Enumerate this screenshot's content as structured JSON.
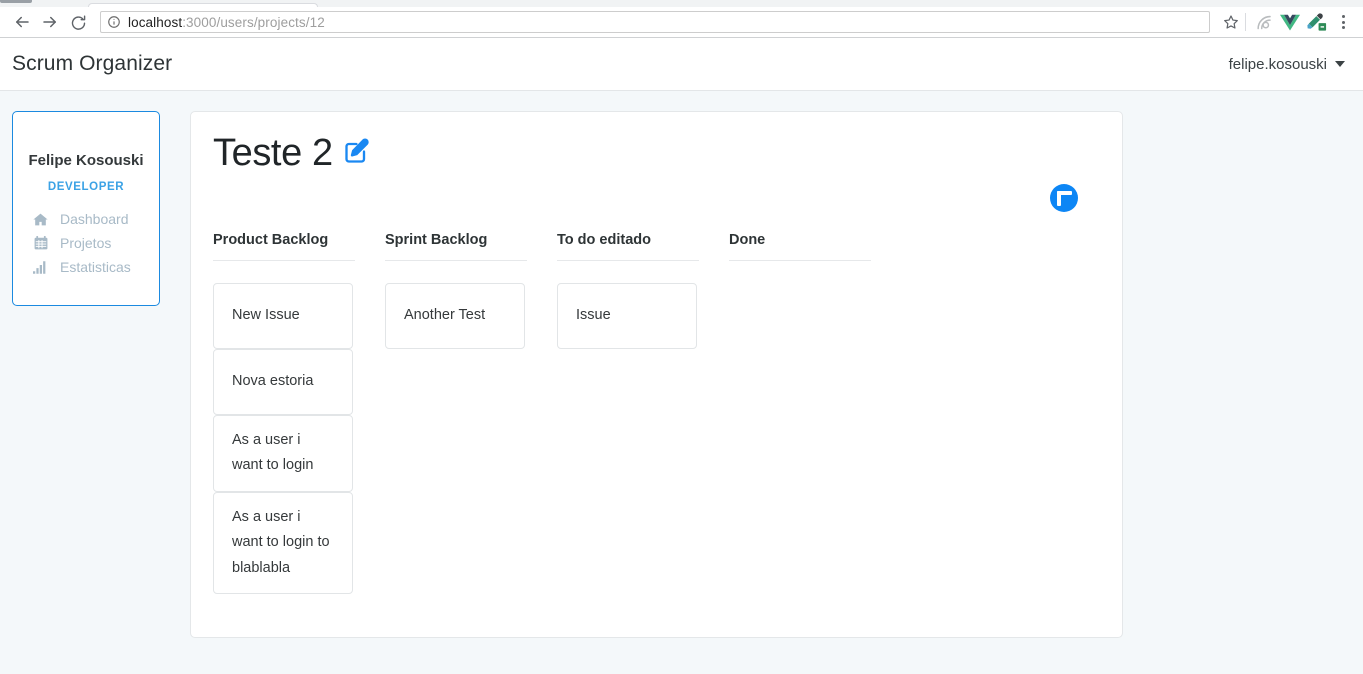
{
  "browser": {
    "back_icon": "arrow-left-icon",
    "forward_icon": "arrow-right-icon",
    "reload_icon": "reload-icon",
    "info_icon": "info-circle-icon",
    "url_host": "localhost",
    "url_path": ":3000/users/projects/12",
    "star_icon": "bookmark-star-icon",
    "extensions": [
      {
        "name": "reader-extension-icon"
      },
      {
        "name": "vue-devtools-icon"
      },
      {
        "name": "eyedropper-extension-icon"
      }
    ],
    "menu_icon": "three-dot-menu-icon"
  },
  "navbar": {
    "brand": "Scrum Organizer",
    "user": "felipe.kosouski",
    "caret_icon": "caret-down-icon"
  },
  "sidebar": {
    "name": "Felipe Kosouski",
    "role": "DEVELOPER",
    "items": [
      {
        "label": "Dashboard",
        "icon": "home-icon"
      },
      {
        "label": "Projetos",
        "icon": "calendar-icon"
      },
      {
        "label": "Estatisticas",
        "icon": "bar-chart-icon"
      }
    ]
  },
  "board": {
    "title": "Teste 2",
    "edit_icon": "edit-pencil-square-icon",
    "add_icon": "plus-circle-icon",
    "columns": [
      {
        "title": "Product Backlog",
        "cards": [
          {
            "text": "New Issue"
          },
          {
            "text": "Nova estoria"
          },
          {
            "text": "As a user i want to login"
          },
          {
            "text": "As a user i want to login to blablabla"
          }
        ]
      },
      {
        "title": "Sprint Backlog",
        "cards": [
          {
            "text": "Another Test"
          }
        ]
      },
      {
        "title": "To do editado",
        "cards": [
          {
            "text": "Issue"
          }
        ]
      },
      {
        "title": "Done",
        "cards": []
      }
    ]
  },
  "colors": {
    "accent_blue": "#0d86f5",
    "role_blue": "#3ba2e5",
    "page_bg": "#f4f8fa",
    "sidebar_border": "#1b8ae0"
  }
}
